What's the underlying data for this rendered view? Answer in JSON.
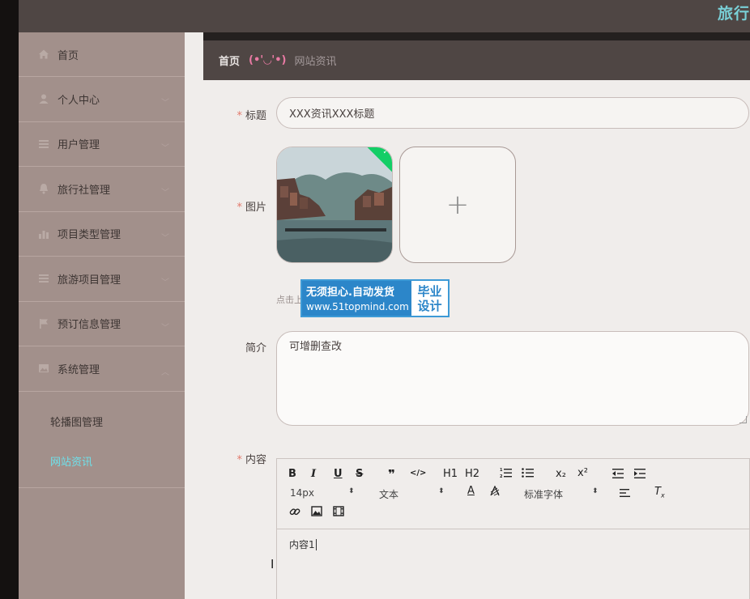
{
  "header": {
    "brand": "旅行"
  },
  "sidebar": {
    "items": [
      {
        "label": "首页",
        "icon": "home-icon"
      },
      {
        "label": "个人中心",
        "icon": "user-icon"
      },
      {
        "label": "用户管理",
        "icon": "list-icon"
      },
      {
        "label": "旅行社管理",
        "icon": "bell-icon"
      },
      {
        "label": "项目类型管理",
        "icon": "chart-icon"
      },
      {
        "label": "旅游项目管理",
        "icon": "list-icon"
      },
      {
        "label": "预订信息管理",
        "icon": "flag-icon"
      },
      {
        "label": "系统管理",
        "icon": "image-icon"
      }
    ],
    "sub": [
      {
        "label": "轮播图管理"
      },
      {
        "label": "网站资讯",
        "active": true
      }
    ]
  },
  "breadcrumb": {
    "home": "首页",
    "face": "(•'◡'•)",
    "current": "网站资讯"
  },
  "form": {
    "title_label": "标题",
    "title_value": "XXX资讯XXX标题",
    "image_label": "图片",
    "upload_tip": "点击上",
    "intro_label": "简介",
    "intro_value": "可增删查改",
    "content_label": "内容",
    "content_value": "内容1"
  },
  "watermark": {
    "line1": "无须担心.自动发货",
    "line2": "www.51topmind.com",
    "right1": "毕业",
    "right2": "设计"
  },
  "editor_toolbar": {
    "bold": "B",
    "italic": "I",
    "underline": "U",
    "strike": "S",
    "quote": "❞",
    "code": "</>",
    "h1": "H1",
    "h2": "H2",
    "sub": "x₂",
    "sup": "x²",
    "size": "14px",
    "text": "文本",
    "font": "标准字体"
  },
  "colors": {
    "accent": "#79cfd6",
    "active": "#6fe0ea",
    "required": "#e2796b",
    "success": "#13ce66"
  }
}
